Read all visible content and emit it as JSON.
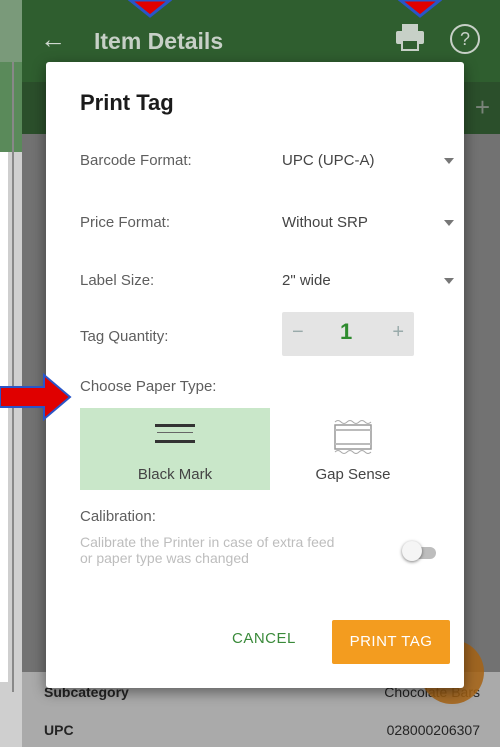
{
  "appbar": {
    "title": "Item Details",
    "back_icon": "←",
    "help_icon": "?"
  },
  "background_rows": [
    {
      "label": "Subcategory",
      "value": "Chocolate Bars"
    },
    {
      "label": "UPC",
      "value": "028000206307"
    }
  ],
  "dialog": {
    "title": "Print Tag",
    "fields": [
      {
        "label": "Barcode Format:",
        "value": "UPC (UPC-A)"
      },
      {
        "label": "Price Format:",
        "value": "Without SRP"
      },
      {
        "label": "Label Size:",
        "value": "2\" wide"
      }
    ],
    "tag_quantity": {
      "label": "Tag Quantity:",
      "value": "1",
      "minus": "−",
      "plus": "+"
    },
    "paper_type": {
      "label": "Choose Paper Type:",
      "options": [
        {
          "label": "Black Mark",
          "selected": true
        },
        {
          "label": "Gap Sense",
          "selected": false
        }
      ]
    },
    "calibration": {
      "label": "Calibration:",
      "description": "Calibrate the Printer in case of extra feed or paper type was changed",
      "enabled": false
    },
    "cancel_label": "CANCEL",
    "print_label": "PRINT TAG"
  },
  "colors": {
    "appbar": "#2f5e2f",
    "accent_orange": "#f39c1f",
    "selected_green": "#c9e7c9",
    "annotation_red": "#e00000"
  }
}
